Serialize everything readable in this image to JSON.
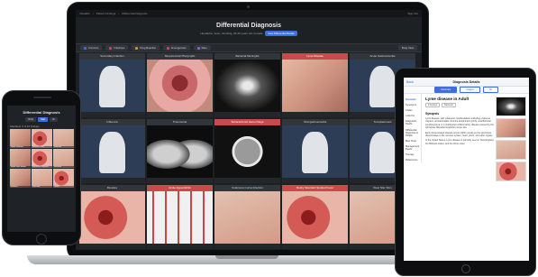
{
  "laptop": {
    "topbar": {
      "crumbs": [
        "VisualDx",
        "Patient Findings",
        "Differential Diagnosis"
      ],
      "right": "Sign Out"
    },
    "title": "Differential Diagnosis",
    "subtitle": "Headache, fever, Vomiting, 25-39 years old, Female",
    "subtitle_pill": "View Differential Details",
    "filters": [
      {
        "label": "Common",
        "color": "#3e6fd8"
      },
      {
        "label": "Infectious",
        "color": "#c94a4a"
      },
      {
        "label": "Drug Reaction",
        "color": "#d98c2a"
      },
      {
        "label": "Emergencies",
        "color": "#c94a4a"
      },
      {
        "label": "Rare",
        "color": "#8a63c9"
      }
    ],
    "filter_right": "Body View",
    "cards": [
      {
        "title": "Secondary Infection",
        "img": "body",
        "red": false
      },
      {
        "title": "Streptococcal Pharyngitis",
        "img": "throat",
        "red": false
      },
      {
        "title": "Bacterial Meningitis",
        "img": "xray",
        "red": false
      },
      {
        "title": "Lyme Disease",
        "img": "skin",
        "red": true
      },
      {
        "title": "Acute Gastroenteritis",
        "img": "body",
        "red": false
      },
      {
        "title": "Influenza",
        "img": "body",
        "red": false
      },
      {
        "title": "Pneumonia",
        "img": "chest",
        "red": false
      },
      {
        "title": "Subarachnoid Hemorrhage",
        "img": "ct",
        "red": true
      },
      {
        "title": "Viral gastroenteritis",
        "img": "body",
        "red": false
      },
      {
        "title": "Toxoplasmosis",
        "img": "body",
        "red": false
      },
      {
        "title": "Measles",
        "img": "red",
        "red": false
      },
      {
        "title": "Acute Appendicitis",
        "img": "stripe",
        "red": true
      },
      {
        "title": "Cutaneous Larva Infection",
        "img": "skin2",
        "red": false
      },
      {
        "title": "Rocky Mountain Spotted Fever",
        "img": "red",
        "red": true
      },
      {
        "title": "West Nile Virus",
        "img": "skin2",
        "red": false
      }
    ],
    "body_labels": [
      "Nausea",
      "Vomiting",
      "Fever",
      "Diarrhea",
      "Abdominal cramp"
    ]
  },
  "phone": {
    "title": "Differential Diagnosis",
    "tabs": [
      "Body",
      "Stat",
      "All"
    ],
    "group_label": "Infectious: 6 of 16 findings",
    "cells": [
      {
        "caption": "Lyme Disease",
        "img": "skin"
      },
      {
        "caption": "Scarlet Fever",
        "img": "red"
      },
      {
        "caption": "Measles",
        "img": "skin2"
      },
      {
        "caption": "Hand Foot Mouth",
        "img": "skin"
      },
      {
        "caption": "Erythema Migrans",
        "img": "red"
      },
      {
        "caption": "Roseola",
        "img": "skin2"
      },
      {
        "caption": "Rubella",
        "img": "skin"
      },
      {
        "caption": "Varicella",
        "img": "skin2"
      },
      {
        "caption": "Tinea",
        "img": "red"
      }
    ]
  },
  "tablet": {
    "nav_back": "Back",
    "nav_title": "Diagnosis Details",
    "tabs": [
      "Summary",
      "Images",
      "All"
    ],
    "sidebar": [
      "Overview",
      "Synonyms",
      "Codes",
      "Look For",
      "Diagnostic Pearls",
      "Differential Diagnosis & Pitfalls",
      "Best Tests",
      "Management Pearls",
      "Therapy",
      "References"
    ],
    "disease": "Lyme disease in Adult",
    "tags": [
      "Infectious",
      "Bacterial"
    ],
    "section": "Synopsis",
    "paragraphs": [
      "Lyme disease, with cutaneous manifestations including erythema migrans, acrodermatitis chronica atrophicans (ACA), and Borrelial lymphocytoma, is a multisystem inflammatory disease caused by the spirochete Borrelia burgdorferi sensu lato.",
      "Early disseminated disease occurs within weeks as the spirochete disseminates to the nervous system, heart, joints, and other organs.",
      "In the United States, Lyme disease is primarily seen in New England, the Midwest states, and the West coast."
    ]
  }
}
